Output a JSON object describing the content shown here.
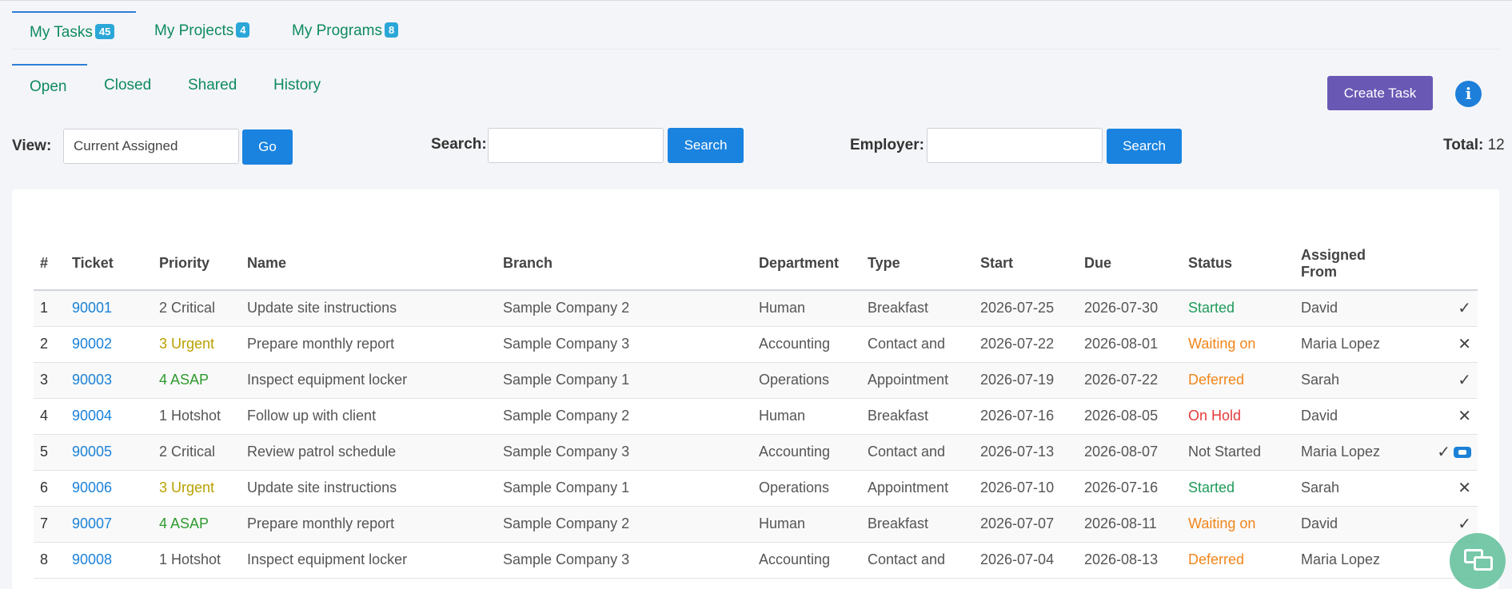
{
  "primary_tabs": [
    {
      "label": "My Tasks",
      "badge": "45"
    },
    {
      "label": "My Projects",
      "badge": "4"
    },
    {
      "label": "My Programs",
      "badge": "8"
    }
  ],
  "secondary_tabs": [
    "Open",
    "Closed",
    "Shared",
    "History"
  ],
  "create_task_label": "Create Task",
  "info_icon": "i",
  "filters": {
    "view_label": "View:",
    "view_value": "Current Assigned",
    "go_label": "Go",
    "search_label": "Search:",
    "search_value": "",
    "search_button": "Search",
    "employer_label": "Employer:",
    "employer_value": "",
    "employer_button": "Search"
  },
  "total": {
    "label": "Total:",
    "value": "12"
  },
  "table": {
    "headers": [
      "#",
      "Ticket",
      "Priority",
      "Name",
      "Branch",
      "Department",
      "Type",
      "Start",
      "Due",
      "Status",
      "Assigned From"
    ],
    "rows": [
      {
        "n": "1",
        "ticket": "90001",
        "priority": "2 Critical",
        "name": "Update site instructions",
        "branch": "Sample Company 2",
        "dept": "Human",
        "type": "Breakfast",
        "start": "2026-07-25",
        "due": "2026-07-30",
        "status": "Started",
        "from": "David",
        "action": "✓"
      },
      {
        "n": "2",
        "ticket": "90002",
        "priority": "3 Urgent",
        "name": "Prepare monthly report",
        "branch": "Sample Company 3",
        "dept": "Accounting",
        "type": "Contact and",
        "start": "2026-07-22",
        "due": "2026-08-01",
        "status": "Waiting on",
        "from": "Maria Lopez",
        "action": "✕"
      },
      {
        "n": "3",
        "ticket": "90003",
        "priority": "4 ASAP",
        "name": "Inspect equipment locker",
        "branch": "Sample Company 1",
        "dept": "Operations",
        "type": "Appointment",
        "start": "2026-07-19",
        "due": "2026-07-22",
        "status": "Deferred",
        "from": "Sarah",
        "action": "✓"
      },
      {
        "n": "4",
        "ticket": "90004",
        "priority": "1 Hotshot",
        "name": "Follow up with client",
        "branch": "Sample Company 2",
        "dept": "Human",
        "type": "Breakfast",
        "start": "2026-07-16",
        "due": "2026-08-05",
        "status": "On Hold",
        "from": "David",
        "action": "✕"
      },
      {
        "n": "5",
        "ticket": "90005",
        "priority": "2 Critical",
        "name": "Review patrol schedule",
        "branch": "Sample Company 3",
        "dept": "Accounting",
        "type": "Contact and",
        "start": "2026-07-13",
        "due": "2026-08-07",
        "status": "Not Started",
        "from": "Maria Lopez",
        "action": "✓"
      },
      {
        "n": "6",
        "ticket": "90006",
        "priority": "3 Urgent",
        "name": "Update site instructions",
        "branch": "Sample Company 1",
        "dept": "Operations",
        "type": "Appointment",
        "start": "2026-07-10",
        "due": "2026-07-16",
        "status": "Started",
        "from": "Sarah",
        "action": "✕"
      },
      {
        "n": "7",
        "ticket": "90007",
        "priority": "4 ASAP",
        "name": "Prepare monthly report",
        "branch": "Sample Company 2",
        "dept": "Human",
        "type": "Breakfast",
        "start": "2026-07-07",
        "due": "2026-08-11",
        "status": "Waiting on",
        "from": "David",
        "action": "✓"
      },
      {
        "n": "8",
        "ticket": "90008",
        "priority": "1 Hotshot",
        "name": "Inspect equipment locker",
        "branch": "Sample Company 3",
        "dept": "Accounting",
        "type": "Contact and",
        "start": "2026-07-04",
        "due": "2026-08-13",
        "status": "Deferred",
        "from": "Maria Lopez",
        "action": ""
      }
    ]
  },
  "colors": {
    "priority": {
      "2 Critical": "#555555",
      "3 Urgent": "#b9a000",
      "4 ASAP": "#2f9a2f",
      "1 Hotshot": "#555555"
    },
    "status": {
      "Started": "#1f9a5a",
      "Waiting on": "#f0861a",
      "Deferred": "#f0861a",
      "On Hold": "#e63b3b",
      "Not Started": "#555555"
    }
  }
}
